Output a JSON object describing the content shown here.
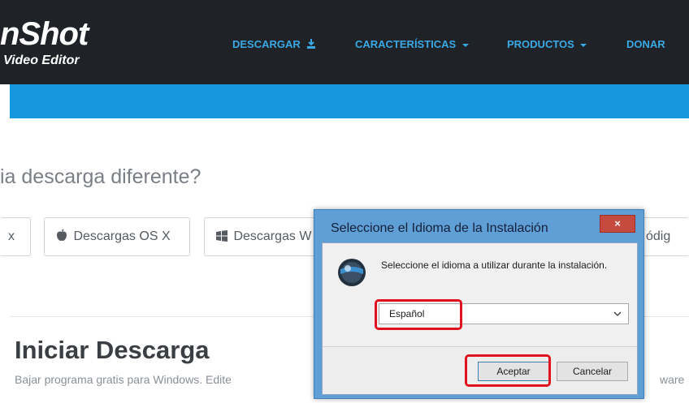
{
  "header": {
    "logo_main": "nShot",
    "logo_sub": "Video Editor",
    "nav": [
      {
        "label": "DESCARGAR",
        "icon": "download-icon"
      },
      {
        "label": "CARACTERÍSTICAS",
        "icon": "caret-down-icon"
      },
      {
        "label": "PRODUCTOS",
        "icon": "caret-down-icon"
      },
      {
        "label": "DONAR"
      }
    ],
    "colors": {
      "bar": "#1f2226",
      "nav_text": "#3aa9e6",
      "band": "#1696dc"
    }
  },
  "main": {
    "alt_download_title": "ia descarga diferente?",
    "buttons": [
      {
        "label": "x"
      },
      {
        "label": "Descargas OS X",
        "icon": "apple-icon"
      },
      {
        "label": "Descargas W",
        "icon": "windows-icon"
      }
    ],
    "start_title": "Iniciar Descarga",
    "start_subtitle": "Bajar programa gratis para Windows. Edite",
    "right_fragment": "ware",
    "right_button_fragment": "ódig"
  },
  "dialog": {
    "title": "Seleccione el Idioma de la Instalación",
    "close_label": "×",
    "message": "Seleccione el idioma a utilizar durante la instalación.",
    "language_selected": "Español",
    "accept_label": "Aceptar",
    "cancel_label": "Cancelar",
    "colors": {
      "highlight": "#e0121d",
      "title_bar": "#5f9fd6",
      "close": "#c74a3f"
    }
  }
}
